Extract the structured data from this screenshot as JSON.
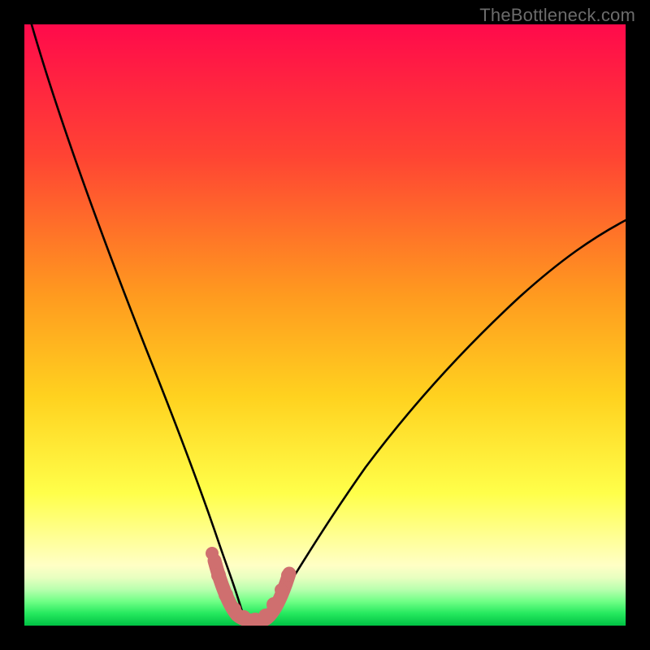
{
  "attribution": "TheBottleneck.com",
  "chart_data": {
    "type": "line",
    "title": "",
    "xlabel": "",
    "ylabel": "",
    "xlim": [
      0,
      100
    ],
    "ylim": [
      0,
      100
    ],
    "grid": false,
    "series": [
      {
        "name": "left-curve",
        "x": [
          2,
          5,
          10,
          15,
          20,
          25,
          28,
          31,
          33,
          34.5,
          36
        ],
        "y": [
          100,
          90,
          73,
          57,
          42,
          27,
          18,
          10,
          5.5,
          2.5,
          0.5
        ]
      },
      {
        "name": "right-curve",
        "x": [
          40,
          42,
          45,
          50,
          55,
          60,
          65,
          70,
          75,
          80,
          85,
          90,
          95,
          100
        ],
        "y": [
          0.5,
          3,
          8,
          17,
          24,
          31,
          37,
          42.5,
          47.5,
          52,
          56,
          60,
          63.5,
          67
        ]
      },
      {
        "name": "highlight-marker-band",
        "x": [
          31.5,
          33,
          34,
          35,
          36,
          37,
          38,
          39,
          40,
          41,
          41.7,
          42.6,
          43.5
        ],
        "y": [
          9.5,
          5.5,
          3.5,
          2.2,
          1.4,
          1.0,
          1.0,
          1.0,
          1.4,
          2.6,
          4.0,
          6.0,
          8.5
        ]
      }
    ],
    "gradient_colors": {
      "top": "#ff0a4b",
      "mid_upper": "#ff5a2f",
      "mid": "#ffd21f",
      "mid_lower": "#ffff55",
      "band_pale": "#ffffa8",
      "green_pale": "#c6ffad",
      "green": "#2fff62",
      "green_deep": "#00d24a"
    },
    "highlight_marker_color": "#cf6f6f",
    "curve_color": "#000000"
  }
}
